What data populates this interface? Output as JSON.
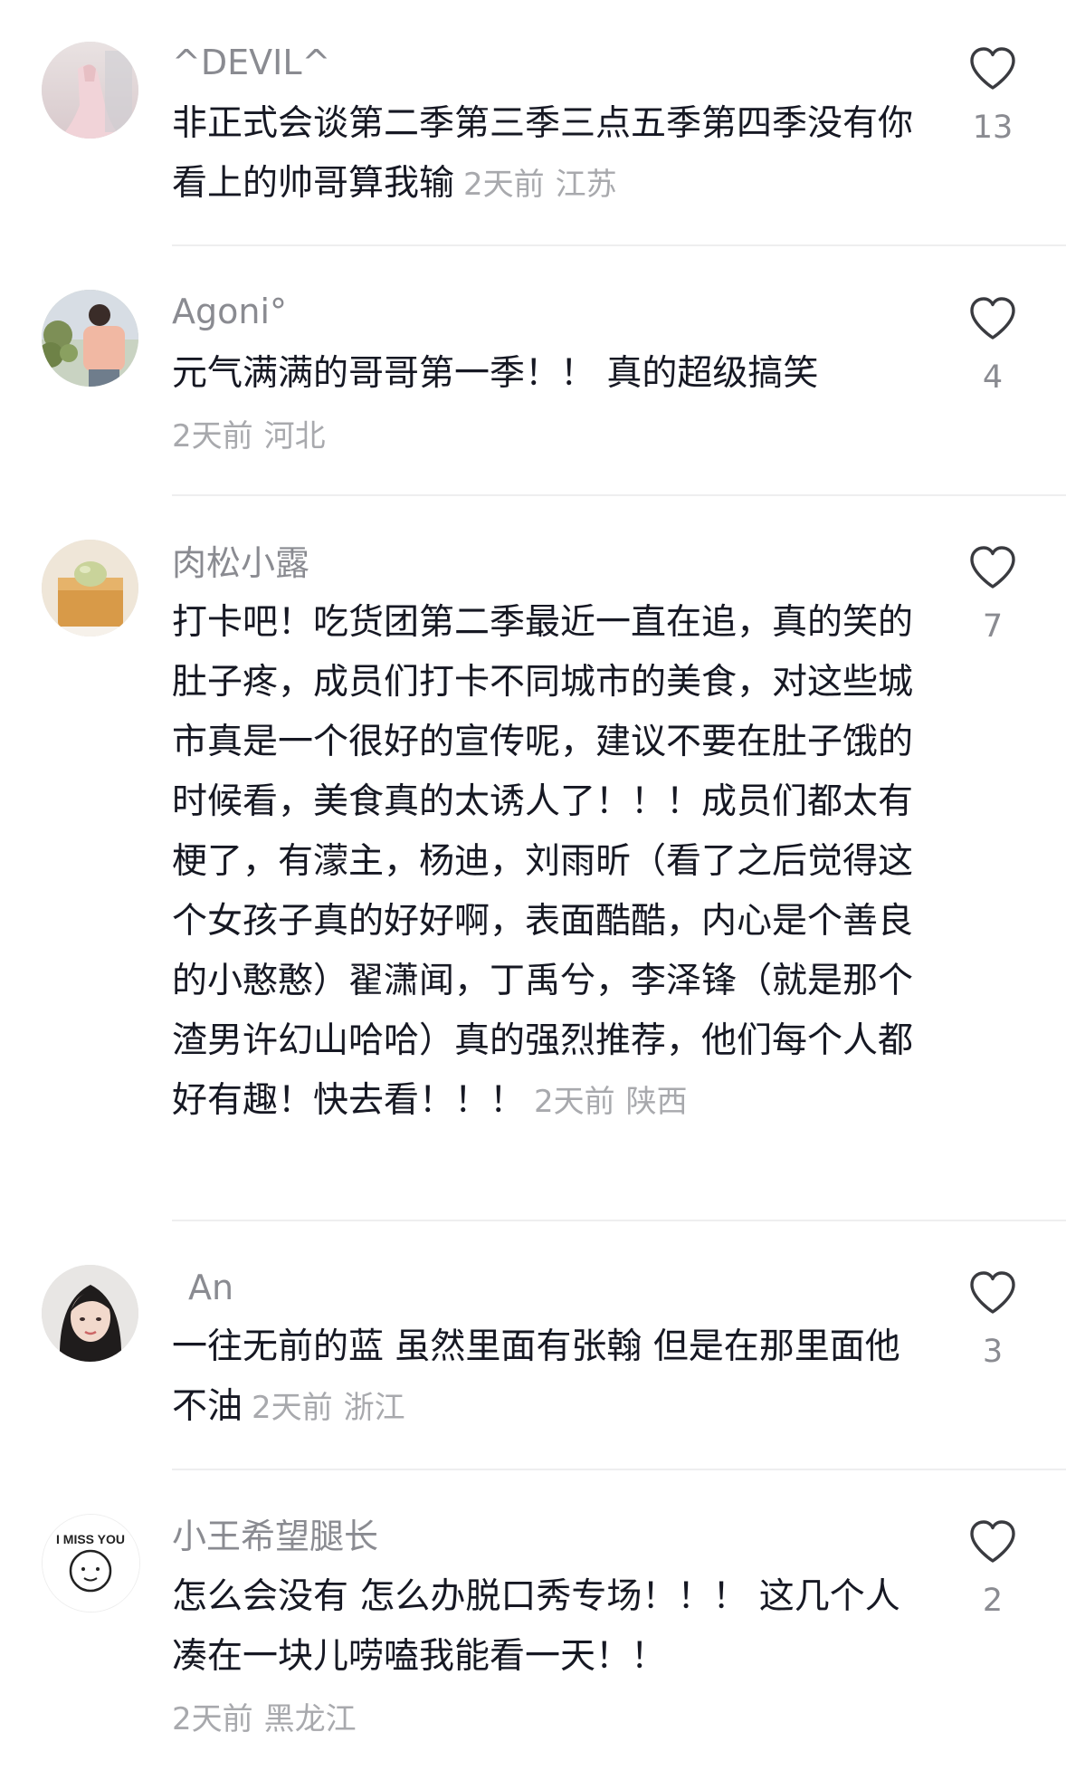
{
  "comments": [
    {
      "username": "^DEVIL^",
      "text": "非正式会谈第二季第三季三点五季第四季没有你看上的帅哥算我输",
      "time": "2天前",
      "location": "江苏",
      "likes": "13"
    },
    {
      "username": "Agoni°",
      "text": "元气满满的哥哥第一季！！ 真的超级搞笑",
      "time": "2天前",
      "location": "河北",
      "likes": "4"
    },
    {
      "username": "肉松小露",
      "text": "打卡吧！吃货团第二季最近一直在追，真的笑的肚子疼，成员们打卡不同城市的美食，对这些城市真是一个很好的宣传呢，建议不要在肚子饿的时候看，美食真的太诱人了！！！成员们都太有梗了，有濛主，杨迪，刘雨昕（看了之后觉得这个女孩子真的好好啊，表面酷酷，内心是个善良的小憨憨）翟潇闻，丁禹兮，李泽锋（就是那个渣男许幻山哈哈）真的强烈推荐，他们每个人都好有趣！快去看！！！",
      "time": "2天前",
      "location": "陕西",
      "likes": "7"
    },
    {
      "username": "An",
      "text": "一往无前的蓝 虽然里面有张翰 但是在那里面他不油",
      "time": "2天前",
      "location": "浙江",
      "likes": "3"
    },
    {
      "username": "小王希望腿长",
      "text": "怎么会没有 怎么办脱口秀专场！！！ 这几个人凑在一块儿唠嗑我能看一天！！",
      "time": "2天前",
      "location": "黑龙江",
      "likes": "2"
    }
  ],
  "avatar5_text": "I MISS YOU"
}
